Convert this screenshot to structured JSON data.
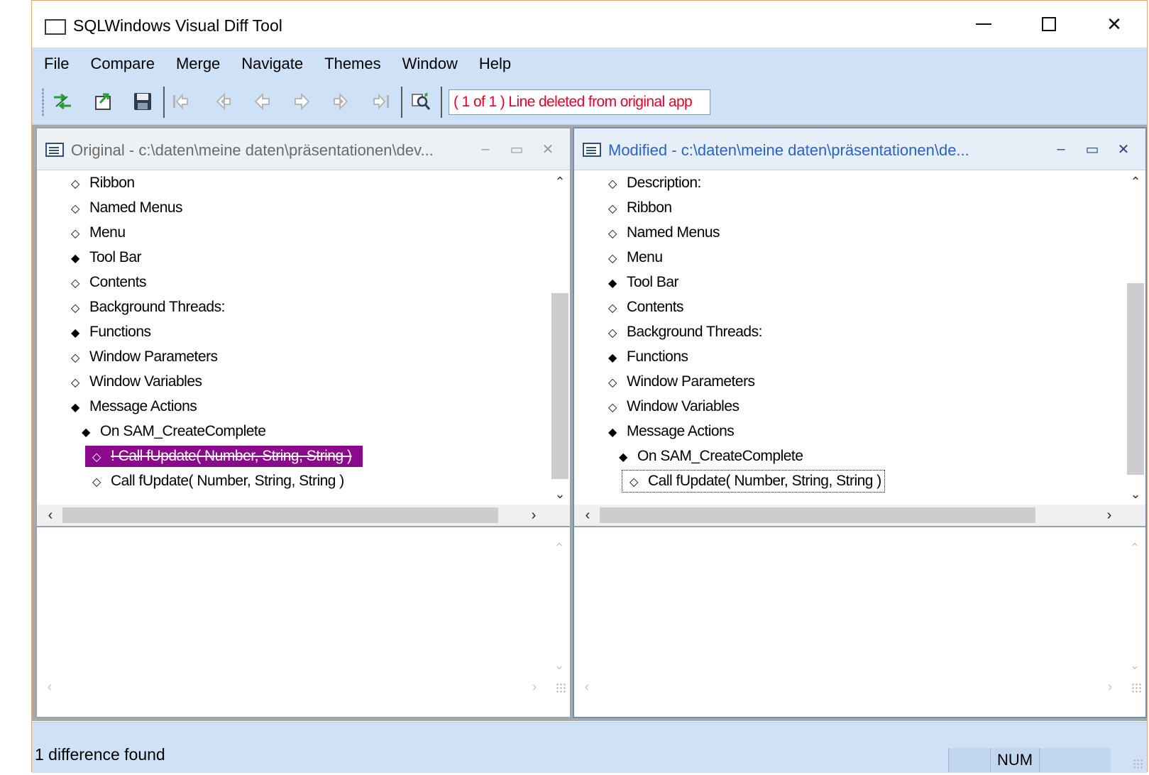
{
  "window": {
    "title": "SQLWindows Visual Diff Tool"
  },
  "menu": [
    "File",
    "Compare",
    "Merge",
    "Navigate",
    "Themes",
    "Window",
    "Help"
  ],
  "toolbar": {
    "buttons": [
      {
        "name": "compare-icon",
        "enabled": true
      },
      {
        "name": "export-icon",
        "enabled": true
      },
      {
        "name": "save-icon",
        "enabled": true
      },
      {
        "name": "first-difference-icon",
        "enabled": false
      },
      {
        "name": "previous-block-icon",
        "enabled": false
      },
      {
        "name": "previous-difference-icon",
        "enabled": false
      },
      {
        "name": "next-difference-icon",
        "enabled": false
      },
      {
        "name": "next-block-icon",
        "enabled": false
      },
      {
        "name": "last-difference-icon",
        "enabled": false
      },
      {
        "name": "find-icon",
        "enabled": true
      }
    ],
    "status_message": "( 1 of 1 )  Line deleted from original app",
    "status_color": "#e8002a"
  },
  "panes": {
    "original": {
      "title": "Original - c:\\daten\\meine daten\\präsentationen\\dev...",
      "rows": [
        {
          "bullet": "◇",
          "text": "Ribbon",
          "indent": 0
        },
        {
          "bullet": "◇",
          "text": "Named Menus",
          "indent": 0
        },
        {
          "bullet": "◇",
          "text": "Menu",
          "indent": 0
        },
        {
          "bullet": "◆",
          "text": "Tool Bar",
          "indent": 0
        },
        {
          "bullet": "◇",
          "text": "Contents",
          "indent": 0
        },
        {
          "bullet": "◇",
          "text": "Background Threads:",
          "indent": 0
        },
        {
          "bullet": "◆",
          "text": "Functions",
          "indent": 0
        },
        {
          "bullet": "◇",
          "text": "Window Parameters",
          "indent": 0
        },
        {
          "bullet": "◇",
          "text": "Window Variables",
          "indent": 0
        },
        {
          "bullet": "◆",
          "text": "Message Actions",
          "indent": 0
        },
        {
          "bullet": "◆",
          "text": "On SAM_CreateComplete",
          "indent": 1
        },
        {
          "bullet": "◇",
          "text": "! Call fUpdate( Number, String, String )",
          "indent": 2,
          "state": "deleted"
        },
        {
          "bullet": "◇",
          "text": "Call fUpdate( Number, String, String )",
          "indent": 2
        }
      ]
    },
    "modified": {
      "title": "Modified - c:\\daten\\meine daten\\präsentationen\\de...",
      "rows": [
        {
          "bullet": "◇",
          "text": "Description:",
          "indent": 0
        },
        {
          "bullet": "◇",
          "text": "Ribbon",
          "indent": 0
        },
        {
          "bullet": "◇",
          "text": "Named Menus",
          "indent": 0
        },
        {
          "bullet": "◇",
          "text": "Menu",
          "indent": 0
        },
        {
          "bullet": "◆",
          "text": "Tool Bar",
          "indent": 0
        },
        {
          "bullet": "◇",
          "text": "Contents",
          "indent": 0
        },
        {
          "bullet": "◇",
          "text": "Background Threads:",
          "indent": 0
        },
        {
          "bullet": "◆",
          "text": "Functions",
          "indent": 0
        },
        {
          "bullet": "◇",
          "text": "Window Parameters",
          "indent": 0
        },
        {
          "bullet": "◇",
          "text": "Window Variables",
          "indent": 0
        },
        {
          "bullet": "◆",
          "text": "Message Actions",
          "indent": 0
        },
        {
          "bullet": "◆",
          "text": "On SAM_CreateComplete",
          "indent": 1
        },
        {
          "bullet": "◇",
          "text": "Call fUpdate( Number, String, String )",
          "indent": 2,
          "state": "focused"
        }
      ]
    }
  },
  "statusbar": {
    "text": "1 difference found",
    "num": "NUM"
  },
  "colors": {
    "deleted_highlight": "#8b0a8b",
    "menubar": "#cfe1f6"
  }
}
